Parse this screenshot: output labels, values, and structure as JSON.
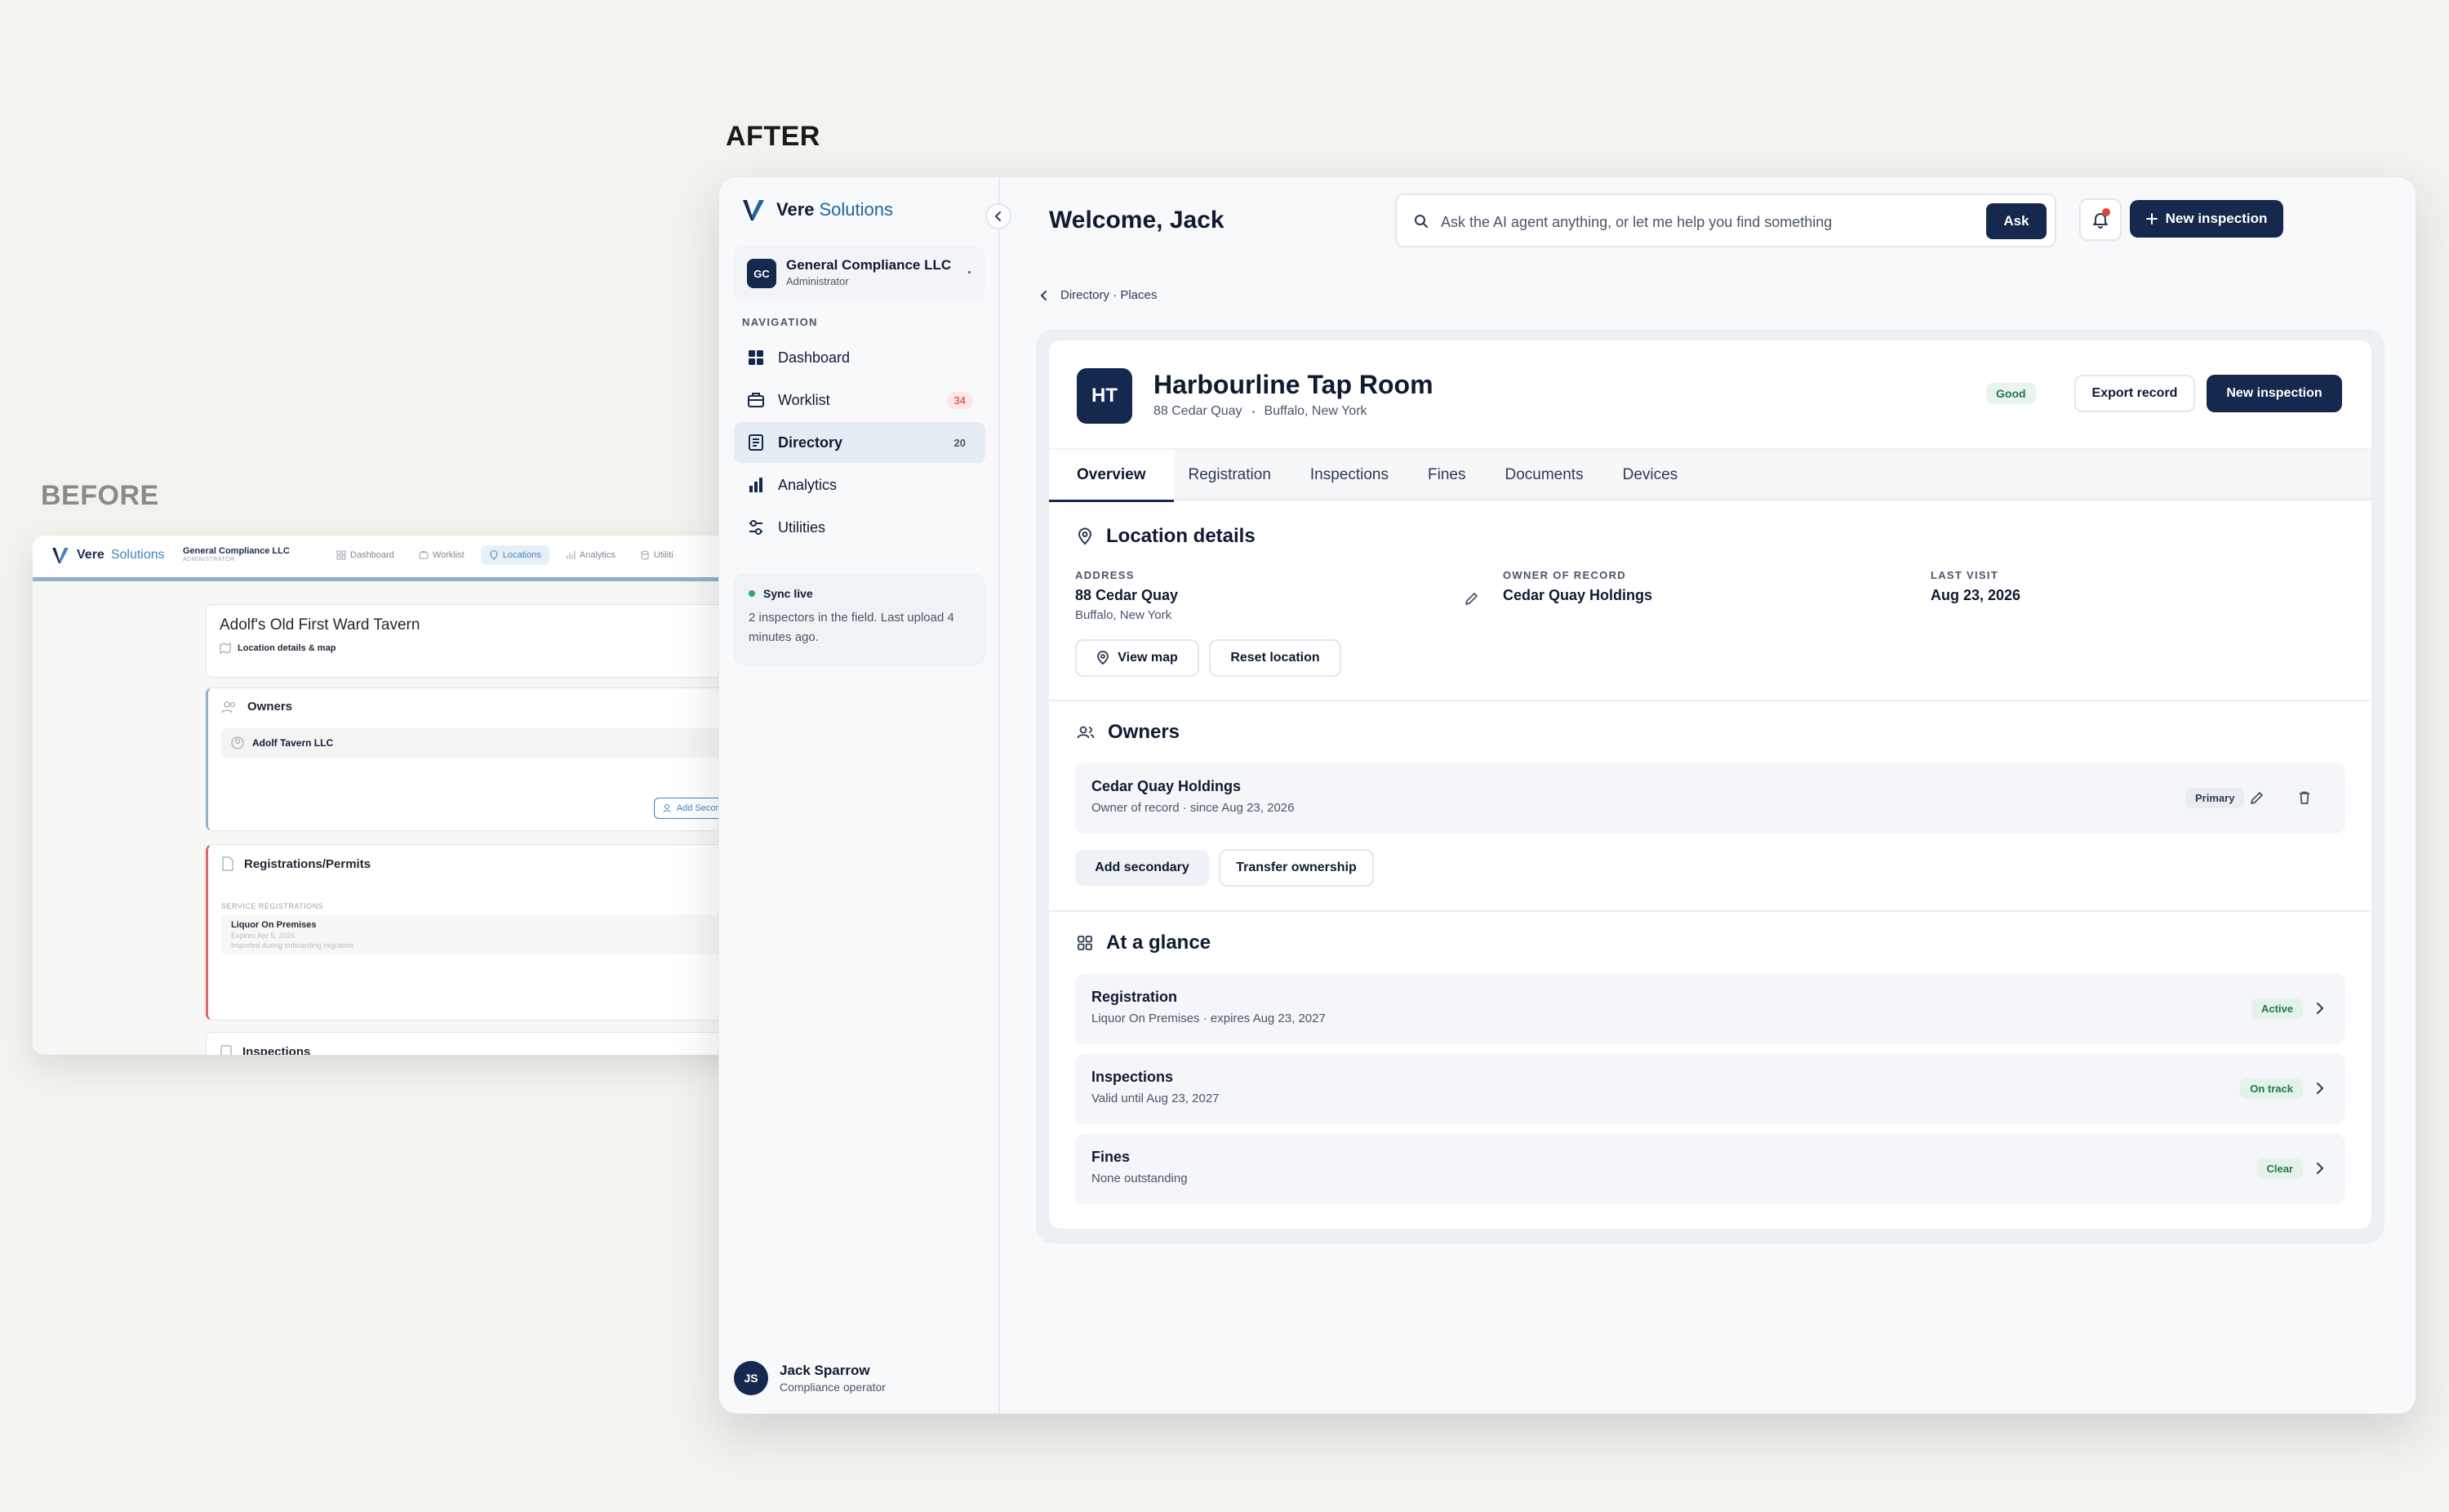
{
  "labels": {
    "before": "BEFORE",
    "after": "AFTER"
  },
  "before": {
    "logo_primary": "Vere",
    "logo_secondary": "Solutions",
    "org_name": "General Compliance LLC",
    "org_role": "ADMINISTRATOR",
    "nav": [
      "Dashboard",
      "Worklist",
      "Locations",
      "Analytics",
      "Utiliti"
    ],
    "title": "Adolf's Old First Ward Tavern",
    "location_details": "Location details & map",
    "owners_heading": "Owners",
    "owner_name": "Adolf Tavern LLC",
    "add_secondary": "Add Secondary",
    "registrations_heading": "Registrations/Permits",
    "service_registrations": "SERVICE REGISTRATIONS",
    "reg_name": "Liquor On Premises",
    "reg_meta1": "Expires Apr 5, 2026",
    "reg_meta2": "Imported during onboarding migration",
    "inspections_heading": "Inspections"
  },
  "sidebar": {
    "brand": "Vere",
    "brand_accent": "Solutions",
    "org_initials": "GC",
    "org_name": "General Compliance LLC",
    "org_role": "Administrator",
    "nav_label": "NAVIGATION",
    "items": [
      {
        "label": "Dashboard",
        "icon": "grid-icon",
        "badge": ""
      },
      {
        "label": "Worklist",
        "icon": "briefcase-icon",
        "badge": "34"
      },
      {
        "label": "Directory",
        "icon": "directory-icon",
        "badge": "20"
      },
      {
        "label": "Analytics",
        "icon": "bar-chart-icon",
        "badge": ""
      },
      {
        "label": "Utilities",
        "icon": "sliders-icon",
        "badge": ""
      }
    ],
    "sync_title": "Sync live",
    "sync_text": "2 inspectors in the field. Last upload 4 minutes ago.",
    "user_initials": "JS",
    "user_name": "Jack Sparrow",
    "user_role": "Compliance operator"
  },
  "header": {
    "welcome": "Welcome, Jack",
    "search_placeholder": "Ask the AI agent anything, or let me help you find something",
    "ask_label": "Ask",
    "new_inspection": "New inspection"
  },
  "breadcrumb": "Directory · Places",
  "place": {
    "initials": "HT",
    "name": "Harbourline Tap Room",
    "street": "88 Cedar Quay",
    "city": "Buffalo, New York",
    "status": "Good",
    "export": "Export record",
    "new_inspection": "New inspection"
  },
  "tabs": [
    "Overview",
    "Registration",
    "Inspections",
    "Fines",
    "Documents",
    "Devices"
  ],
  "location": {
    "heading": "Location details",
    "address_label": "ADDRESS",
    "address_value": "88 Cedar Quay",
    "address_city": "Buffalo, New York",
    "owner_label": "OWNER OF RECORD",
    "owner_value": "Cedar Quay Holdings",
    "visit_label": "LAST VISIT",
    "visit_value": "Aug 23, 2026",
    "view_map": "View map",
    "reset_location": "Reset location"
  },
  "owners": {
    "heading": "Owners",
    "name": "Cedar Quay Holdings",
    "sub": "Owner of record · since Aug 23, 2026",
    "badge": "Primary",
    "add_secondary": "Add secondary",
    "transfer": "Transfer ownership"
  },
  "glance": {
    "heading": "At a glance",
    "rows": [
      {
        "title": "Registration",
        "sub": "Liquor On Premises · expires Aug 23, 2027",
        "badge": "Active"
      },
      {
        "title": "Inspections",
        "sub": "Valid until Aug 23, 2027",
        "badge": "On track"
      },
      {
        "title": "Fines",
        "sub": "None outstanding",
        "badge": "Clear"
      }
    ]
  },
  "colors": {
    "navy": "#15284d",
    "accent": "#24659f",
    "success": "#1f7a48",
    "danger": "#e0443a"
  }
}
